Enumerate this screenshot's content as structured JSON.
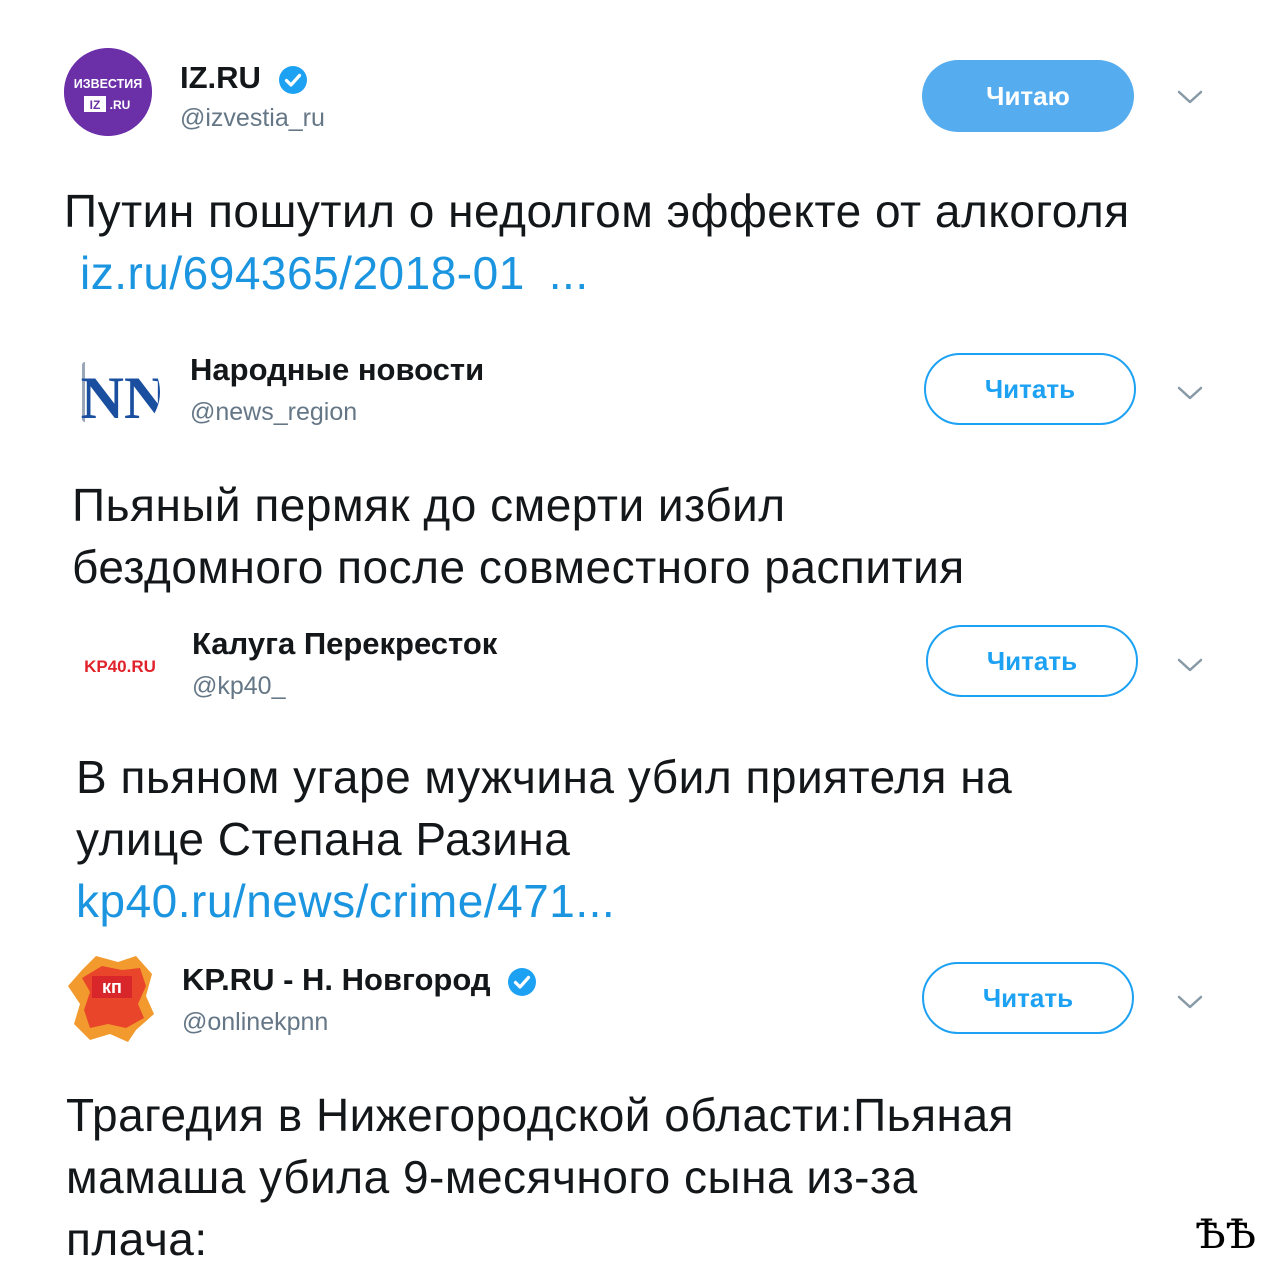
{
  "tweets": [
    {
      "name": "IZ.RU",
      "handle": "@izvestia_ru",
      "verified": true,
      "follow_label": "Читаю",
      "avatar": {
        "line1": "ИЗВЕСТИЯ",
        "badge": "IZ",
        "line2": ".RU",
        "color": "#6b2fa8"
      },
      "text": "Путин пошутил о недолгом эффекте от алкоголя",
      "link": "iz.ru/694365/2018-01",
      "ellipsis": "..."
    },
    {
      "name": "Народные новости",
      "handle": "@news_region",
      "verified": false,
      "follow_label": "Читать",
      "avatar": {
        "logo": "NN",
        "color": "#1a4fa0"
      },
      "text_lines": [
        "Пьяный пермяк до смерти избил",
        "бездомного после совместного распития"
      ]
    },
    {
      "name": "Калуга Перекресток",
      "handle": "@kp40_",
      "verified": false,
      "follow_label": "Читать",
      "avatar": {
        "logo": "KP40.RU",
        "color": "#e0222b"
      },
      "text_lines": [
        "В пьяном угаре мужчина убил приятеля на",
        "улице Степана Разина"
      ],
      "link": "kp40.ru/news/crime/471..."
    },
    {
      "name": "KP.RU - Н. Новгород",
      "handle": "@onlinekpnn",
      "verified": true,
      "follow_label": "Читать",
      "avatar": {
        "logo": "кп",
        "color": "#d8262b"
      },
      "text_lines": [
        "Трагедия в Нижегородской области:Пьяная",
        "мамаша убила 9-месячного сына из-за",
        "плача:"
      ]
    }
  ],
  "colors": {
    "accent": "#1da1f2",
    "link": "#1b95e0",
    "handle": "#657786"
  },
  "watermark": "ѢѢ"
}
